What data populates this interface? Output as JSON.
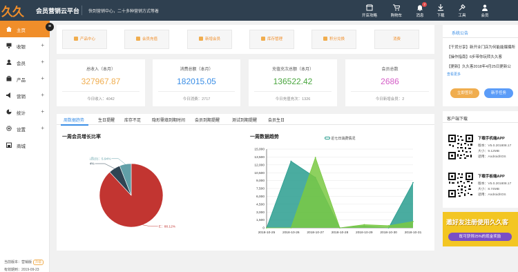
{
  "header": {
    "logo_text": "久久客",
    "platform_title": "会员营销云平台",
    "notice": "快到营销中心，二十多种营销方式等着",
    "nav": [
      {
        "label": "开店攻略",
        "icon": "store-icon"
      },
      {
        "label": "购物车",
        "icon": "cart-icon"
      },
      {
        "label": "消息",
        "icon": "bell-icon",
        "badge": "7"
      },
      {
        "label": "下载",
        "icon": "download-icon"
      },
      {
        "label": "工具",
        "icon": "tools-icon"
      },
      {
        "label": "会员",
        "icon": "user-icon"
      }
    ]
  },
  "sidebar": {
    "items": [
      {
        "label": "主页",
        "icon": "home-icon",
        "expandable": false
      },
      {
        "label": "收银",
        "icon": "monitor-icon",
        "expandable": true
      },
      {
        "label": "会员",
        "icon": "members-icon",
        "expandable": true
      },
      {
        "label": "产品",
        "icon": "product-icon",
        "expandable": true
      },
      {
        "label": "营销",
        "icon": "marketing-icon",
        "expandable": true
      },
      {
        "label": "统计",
        "icon": "stats-icon",
        "expandable": true
      },
      {
        "label": "设置",
        "icon": "settings-icon",
        "expandable": true
      },
      {
        "label": "商城",
        "icon": "mall-icon",
        "expandable": false
      }
    ],
    "plus": "+",
    "collapse_icon": "≡",
    "version_label": "当前版本：营销版",
    "version_badge": "升级",
    "expiry": "有效期到：2019-09-23"
  },
  "quick_buttons": [
    "产品中心",
    "会员充值",
    "新增会员",
    "库存管理",
    "积分兑换",
    "消费"
  ],
  "stats": [
    {
      "title": "总收入（本月）",
      "value": "327967.87",
      "sub": "今日收入：4042",
      "color": "#f0ad4e"
    },
    {
      "title": "消费总额（本月）",
      "value": "182015.05",
      "sub": "今日消费：2717",
      "color": "#3a8ee6"
    },
    {
      "title": "充值充次总额（本月）",
      "value": "136522.42",
      "sub": "今日充值充次：1326",
      "color": "#4aa63f"
    },
    {
      "title": "会员总数",
      "value": "2686",
      "sub": "今日新增会员：2",
      "color": "#d45dc7"
    }
  ],
  "tabs": [
    "周数据趋势",
    "生日提醒",
    "库存不足",
    "隐形需填到期时间",
    "会员到期提醒",
    "测试到期提醒",
    "会员生日"
  ],
  "pie_chart": {
    "title": "一周会员增长比率"
  },
  "line_chart": {
    "title": "一周数据趋势",
    "legend": "近七日消费情况"
  },
  "chart_data": [
    {
      "type": "pie",
      "title": "一周会员增长比率",
      "slices": [
        {
          "label": "E",
          "value": 88.12,
          "display": "E：88.12%",
          "color": "#c23531"
        },
        {
          "label": "测试",
          "value": 5.94,
          "display": "测试：5.94%",
          "color": "#2f4554"
        },
        {
          "label": "普通会员",
          "value": 5.94,
          "display": "普通会员(0)：5.94%",
          "color": "#61a0a8"
        }
      ]
    },
    {
      "type": "area",
      "title": "一周数据趋势",
      "legend": [
        "近七日消费情况"
      ],
      "x": [
        "2018-10-25",
        "2018-10-26",
        "2018-10-27",
        "2018-10-28",
        "2018-10-29",
        "2018-10-30",
        "2018-10-31"
      ],
      "yticks": [
        0,
        1500,
        3000,
        4500,
        6000,
        7500,
        9000,
        10500,
        12000,
        13500,
        15000
      ],
      "ylim": [
        0,
        15000
      ],
      "series": [
        {
          "color": "#2a9d8f",
          "values": [
            0,
            12700,
            9600,
            0,
            350,
            0,
            8600
          ]
        },
        {
          "color": "#7ac943",
          "values": [
            0,
            0,
            13400,
            0,
            600,
            400,
            1200
          ]
        }
      ]
    }
  ],
  "right_panel": {
    "notice_tab": "系统公告",
    "news": [
      "【干货分享】新开业门店为何能能爆爆所",
      "【操作指南】6步带你玩转久久客",
      "【更新】久久客2018年4月25日更新公"
    ],
    "more": "查看更多",
    "btn_signin": "立即签到",
    "btn_task": "新手任务",
    "download_title": "客户端下载",
    "apps": [
      {
        "title": "下载手机端APP",
        "version": "版本：V5.0.201808.17",
        "size": "大小：9.12MB",
        "platform": "适用：Android/IOS"
      },
      {
        "title": "下载手板端APP",
        "version": "版本：V5.0.201808.17",
        "size": "大小：8.74MB",
        "platform": "适用：Android/IOS"
      }
    ],
    "promo_title": "邀好友注册使用久久客",
    "promo_sub": "既可获得25%的现金奖励"
  },
  "colors": {
    "header_bg": "#2f4050",
    "accent": "#f08e2a",
    "active_tab": "#3a8ee6"
  }
}
